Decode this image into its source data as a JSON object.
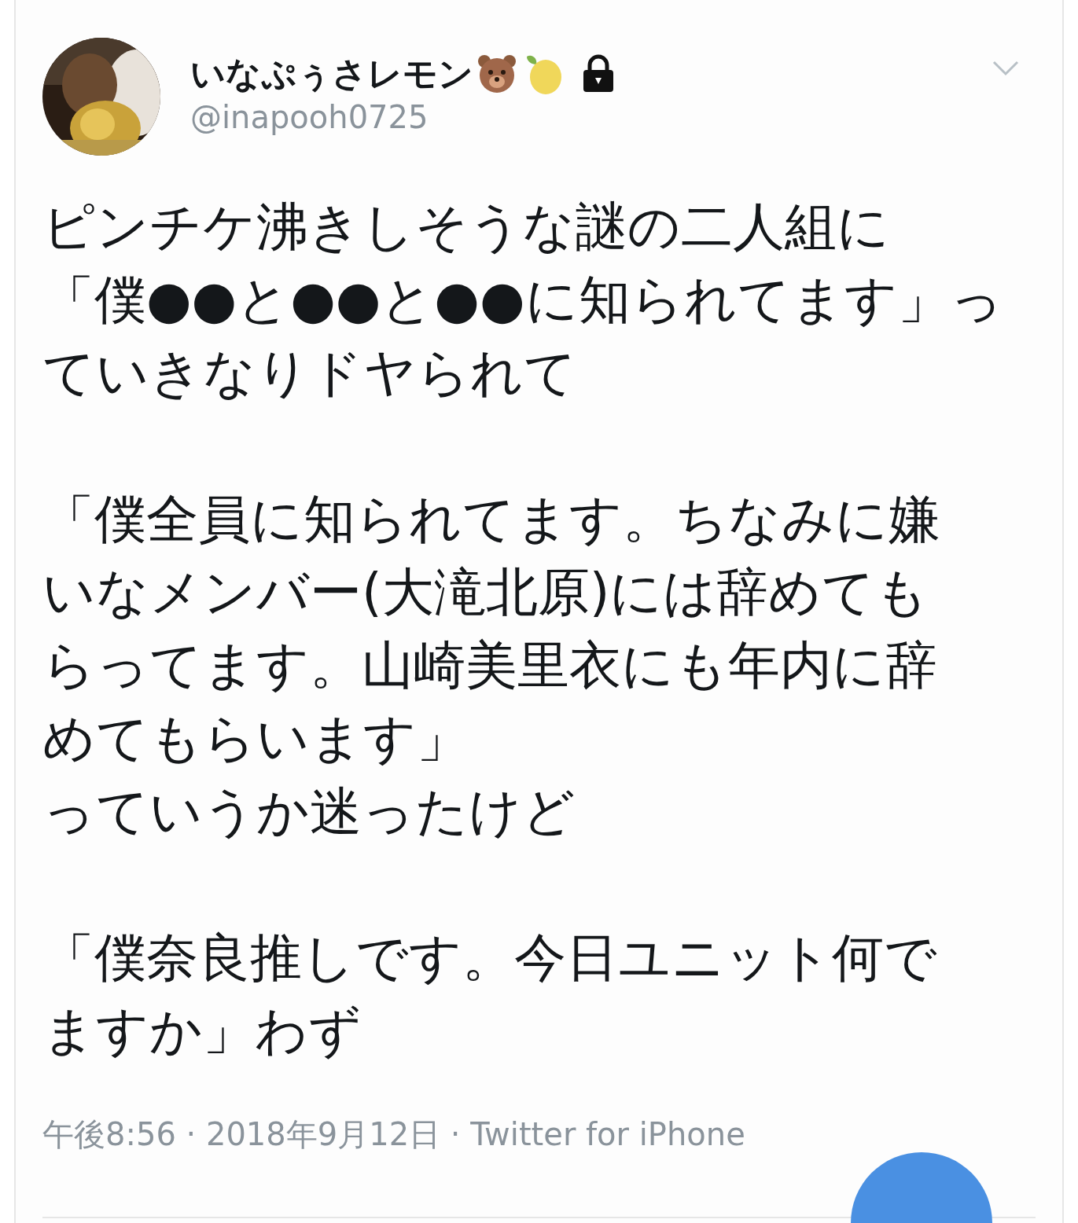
{
  "tweet": {
    "author": {
      "name": "いなぷぅさレモン",
      "handle": "@inapooh0725",
      "protected": true
    },
    "paragraphs": [
      [
        "ピンチケ沸きしそうな謎の二人組に",
        "「僕●●と●●と●●に知られてます」っ",
        "ていきなりドヤられて"
      ],
      [
        "「僕全員に知られてます。ちなみに嫌",
        "いなメンバー(大滝北原)には辞めても",
        "らってます。山崎美里衣にも年内に辞",
        "めてもらいます」",
        "っていうか迷ったけど"
      ],
      [
        "「僕奈良推しです。今日ユニット何で",
        "ますか」わず"
      ]
    ],
    "meta": "午後8:56 · 2018年9月12日 · Twitter for iPhone"
  }
}
